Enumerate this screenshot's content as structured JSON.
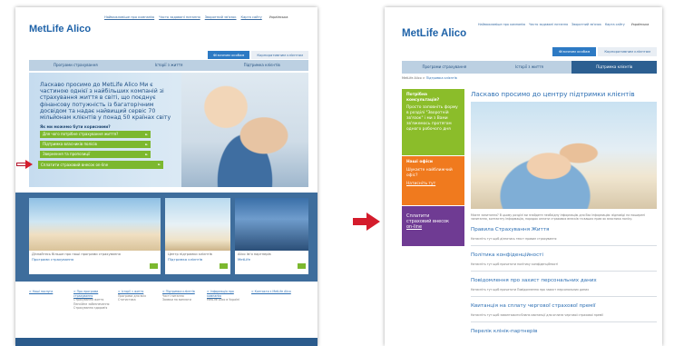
{
  "colors": {
    "brand_blue": "#1e62a8",
    "accent_green": "#7cb82f",
    "arrow_red": "#d41c2c",
    "nav_active": "#2c5f91"
  },
  "left": {
    "logo": "MetLife Alico",
    "top_links": [
      "Найважливіше про компанію",
      "Часто задавані питання",
      "Зворотний зв'язок",
      "Карта сайту"
    ],
    "language": "Українська",
    "tabs_right": [
      "Фізичним особам",
      "Корпоративним клієнтам"
    ],
    "nav": [
      "Програми страхування",
      "Історії з життя",
      "Підтримка клієнтів"
    ],
    "hero_text": "Ласкаво просимо до MetLife Alico Ми є частиною однієї з найбільших компаній зі страхування життя в світі, що поєднує фінансову потужність із багаторічним досвідом та надає найвищий сервіс 70 мільйонам клієнтів у понад 50 країнах світу",
    "hero_question": "Як ми можемо бути корисними?",
    "buttons": [
      "Для чого потрібне страхування життя?",
      "Підтримка власників полісів",
      "Звернення та пропозиції",
      "Сплатити страховий внесок on-line"
    ],
    "cards": [
      {
        "caption": "Дізнайтесь більше про наші програми страхування",
        "link": "Програми страхування"
      },
      {
        "caption": "Центр підтримки клієнтів",
        "link": "Підтримка клієнтів"
      },
      {
        "caption": "Alico ім'я партнерів",
        "link": "MetLife"
      }
    ],
    "footer_cols": [
      [
        "> Наші послуги"
      ],
      [
        "> Про програми страхування",
        "Страхування життя",
        "Пенсійне забезпечення",
        "Страхування здоров'я"
      ],
      [
        "> Історії з життя",
        "Програма для всіх",
        "Статистика"
      ],
      [
        "> Підтримка клієнтів",
        "Часті питання",
        "Заявки на виплати"
      ],
      [
        "> Інформація про компанію",
        "MetLife Alico в Україні"
      ],
      [
        "> Контакти з MetLife Alico"
      ]
    ]
  },
  "right": {
    "logo": "MetLife Alico",
    "top_links": [
      "Найважливіше про компанію",
      "Часто задавані питання",
      "Зворотний зв'язок",
      "Карта сайту"
    ],
    "language": "Українська",
    "tabs_right": [
      "Фізичним особам",
      "Корпоративним клієнтам"
    ],
    "nav": [
      "Програми страхування",
      "Історії з життя",
      "Підтримка клієнтів"
    ],
    "breadcrumb_home": "MetLife Alico",
    "breadcrumb_sep": ">",
    "breadcrumb_current": "Підтримка клієнтів",
    "side_green": {
      "title": "Потрібна консультація?",
      "body": "Просто заповніть форму в розділі \"Зворотній зв'язок\" і ми з Вами зв'яжемось протягом одного робочого дня"
    },
    "side_orange": {
      "title": "Наші офіси",
      "body": "Шукаєте найближчий офіс?",
      "link": "Натисніть тут"
    },
    "side_purple": {
      "line1": "Сплатити",
      "line2": "страховий внесок",
      "line3": "on-line"
    },
    "heading": "Ласкаво просимо до центру підтримки клієнтів",
    "intro": "Маєте запитання? В цьому розділі ви знайдете необхідну інформацію для Вас інформацію: відповіді на поширені запитання, контактну інформацію, порядок оплати страхових внесків та ваших прав як власника полісу.",
    "sections": [
      {
        "title": "Правила Страхування Життя",
        "sub": "Натисніть тут щоб дізнатись текст правил страхування"
      },
      {
        "title": "Політика конфіденційності",
        "sub": "Натисніть тут щоб прочитати політику конфіденційності"
      },
      {
        "title": "Повідомлення про захист персональних даних",
        "sub": "Натисніть тут щоб прочитати Повідомлення про захист персональних даних"
      },
      {
        "title": "Квитанція на сплату чергової страхової премії",
        "sub": "Натисніть тут щоб завантажити бланк квитанції для оплати чергової страхової премії"
      },
      {
        "title": "Перелік клінік-партнерів",
        "sub": ""
      }
    ]
  }
}
